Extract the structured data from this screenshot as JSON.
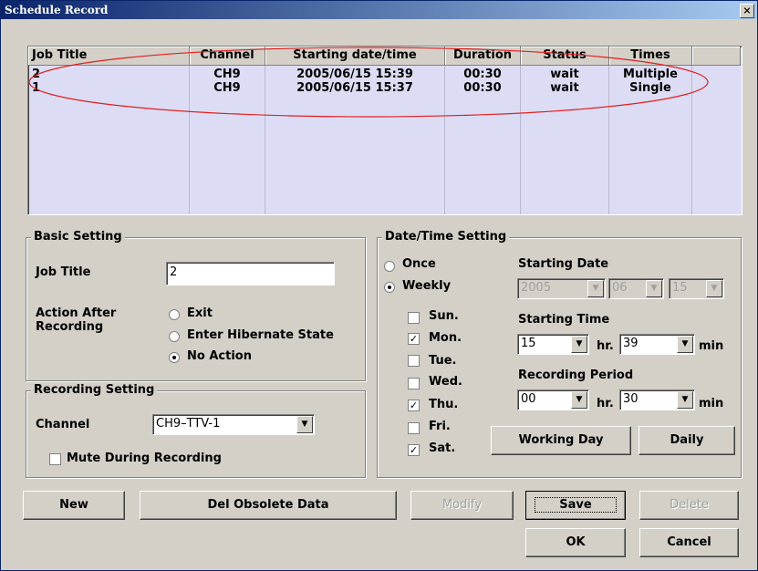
{
  "window": {
    "title": "Schedule Record",
    "close_glyph": "×"
  },
  "list": {
    "columns": [
      "Job Title",
      "Channel",
      "Starting date/time",
      "Duration",
      "Status",
      "Times"
    ],
    "rows": [
      [
        "2",
        "CH9",
        "2005/06/15 15:39",
        "00:30",
        "wait",
        "Multiple"
      ],
      [
        "1",
        "CH9",
        "2005/06/15 15:37",
        "00:30",
        "wait",
        "Single"
      ]
    ],
    "highlight_color": "#e02020"
  },
  "basic": {
    "group_label": "Basic Setting",
    "job_title_label": "Job Title",
    "job_title_value": "2",
    "action_label_1": "Action After",
    "action_label_2": "Recording",
    "options": [
      "Exit",
      "Enter Hibernate State",
      "No Action"
    ],
    "selected": "No Action"
  },
  "recording": {
    "group_label": "Recording Setting",
    "channel_label": "Channel",
    "channel_value": "CH9–TTV-1",
    "mute_label": "Mute During Recording",
    "mute_checked": false
  },
  "datetime": {
    "group_label": "Date/Time Setting",
    "once_label": "Once",
    "weekly_label": "Weekly",
    "mode": "Weekly",
    "days": [
      {
        "label": "Sun.",
        "checked": false
      },
      {
        "label": "Mon.",
        "checked": true
      },
      {
        "label": "Tue.",
        "checked": false
      },
      {
        "label": "Wed.",
        "checked": false
      },
      {
        "label": "Thu.",
        "checked": true
      },
      {
        "label": "Fri.",
        "checked": false
      },
      {
        "label": "Sat.",
        "checked": true
      }
    ],
    "start_date_label": "Starting Date",
    "year": "2005",
    "month": "06",
    "day": "15",
    "start_time_label": "Starting Time",
    "hour": "15",
    "hr_label": "hr.",
    "minute": "39",
    "min_label": "min",
    "period_label": "Recording Period",
    "period_hour": "00",
    "period_minute": "30",
    "working_day_label": "Working Day",
    "daily_label": "Daily"
  },
  "buttons": {
    "new": "New",
    "del_obsolete": "Del Obsolete Data",
    "modify": "Modify",
    "save": "Save",
    "delete": "Delete",
    "ok": "OK",
    "cancel": "Cancel"
  },
  "check_glyph": "✓",
  "dropdown_glyph": "▼"
}
